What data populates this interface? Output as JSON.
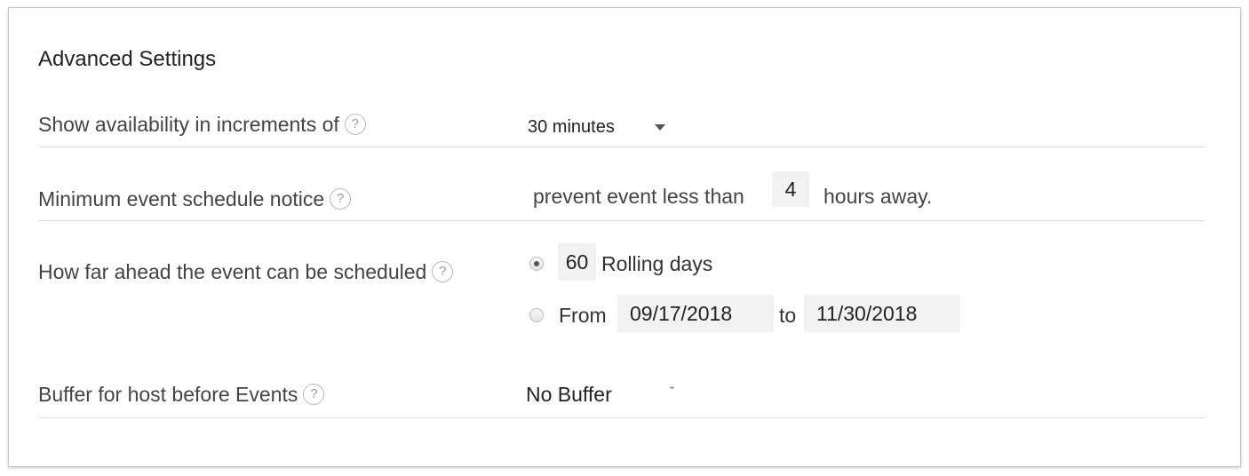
{
  "section": {
    "title": "Advanced Settings"
  },
  "rows": {
    "increments": {
      "label": "Show availability in increments of",
      "help": "?",
      "value": "30 minutes"
    },
    "notice": {
      "label": "Minimum event schedule notice",
      "help": "?",
      "prefix": "prevent event less than",
      "value": "4",
      "suffix": "hours away."
    },
    "ahead": {
      "label": "How far ahead the event can be scheduled",
      "help": "?",
      "rolling_selected": true,
      "rolling_value": "60",
      "rolling_label": "Rolling days",
      "from_label": "From",
      "from_date": "09/17/2018",
      "to_label": "to",
      "to_date": "11/30/2018"
    },
    "buffer": {
      "label": "Buffer for host before Events",
      "help": "?",
      "value": "No Buffer",
      "chevron": "ˇ"
    }
  }
}
